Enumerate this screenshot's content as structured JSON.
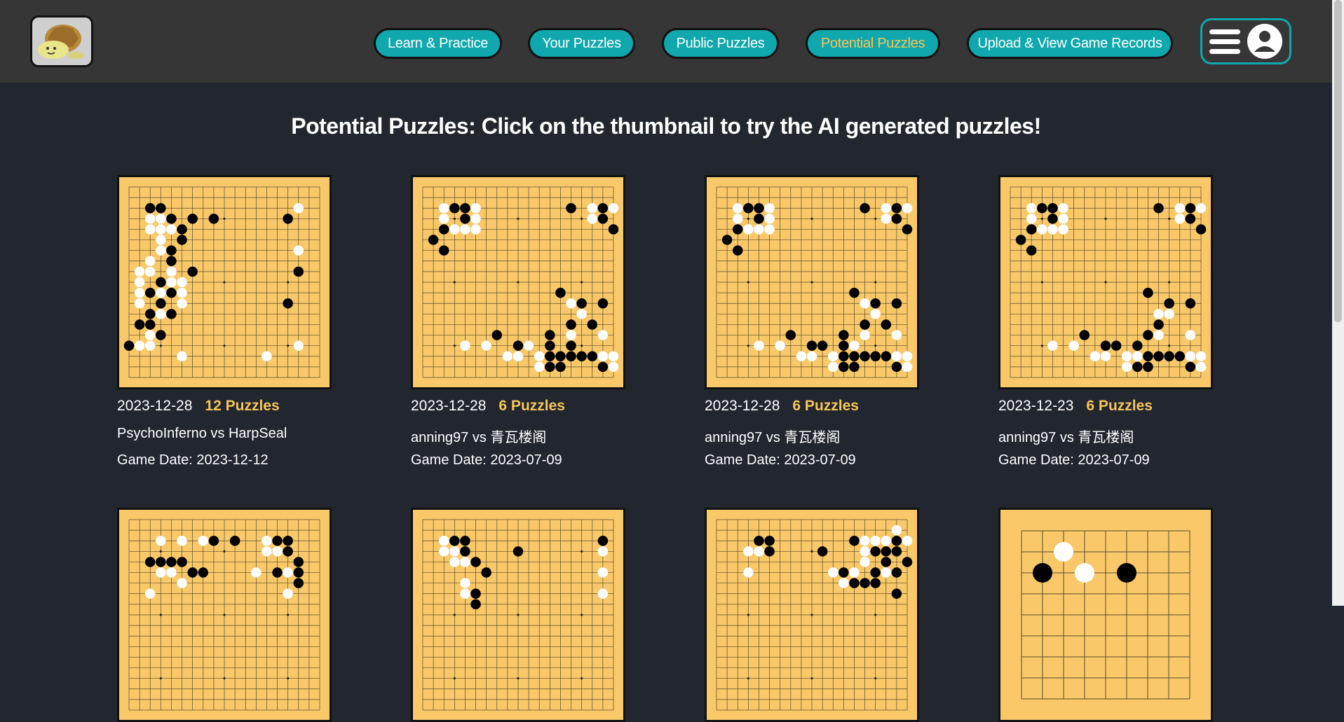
{
  "header": {
    "logo_icon": "turtle-logo-icon",
    "nav": [
      {
        "label": "Learn & Practice",
        "active": false
      },
      {
        "label": "Your Puzzles",
        "active": false
      },
      {
        "label": "Public Puzzles",
        "active": false
      },
      {
        "label": "Potential Puzzles",
        "active": true
      },
      {
        "label": "Upload & View Game Records",
        "active": false
      }
    ],
    "menu_icons": [
      "hamburger-icon",
      "user-avatar-icon"
    ]
  },
  "colors": {
    "accent_teal": "#10a8ad",
    "highlight_gold": "#f7c55a",
    "board": "#f9c969",
    "page_bg": "#22262e",
    "header_bg": "#363636"
  },
  "main": {
    "title": "Potential Puzzles: Click on the thumbnail to try the AI generated puzzles!",
    "cards": [
      {
        "date": "2023-12-28",
        "count": "12 Puzzles",
        "players": "PsychoInferno vs HarpSeal",
        "game_date": "Game Date: 2023-12-12"
      },
      {
        "date": "2023-12-28",
        "count": "6 Puzzles",
        "players": "anning97 vs 青瓦楼阁",
        "game_date": "Game Date: 2023-07-09"
      },
      {
        "date": "2023-12-28",
        "count": "6 Puzzles",
        "players": "anning97 vs 青瓦楼阁",
        "game_date": "Game Date: 2023-07-09"
      },
      {
        "date": "2023-12-23",
        "count": "6 Puzzles",
        "players": "anning97 vs 青瓦楼阁",
        "game_date": "Game Date: 2023-07-09"
      },
      {
        "date": "",
        "count": "",
        "players": "",
        "game_date": ""
      },
      {
        "date": "",
        "count": "",
        "players": "",
        "game_date": ""
      },
      {
        "date": "",
        "count": "",
        "players": "",
        "game_date": ""
      },
      {
        "date": "",
        "count": "",
        "players": "",
        "game_date": ""
      }
    ]
  }
}
